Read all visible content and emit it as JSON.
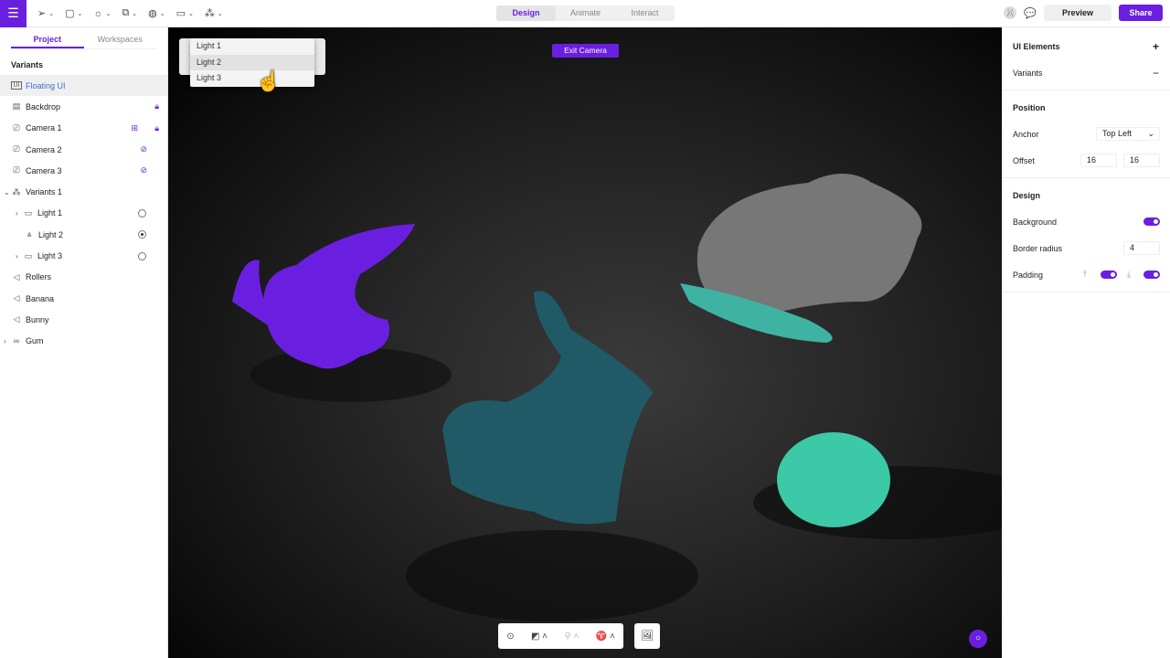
{
  "topbar": {
    "modes": [
      "Design",
      "Animate",
      "Interact"
    ],
    "active_mode": "Design",
    "preview": "Preview",
    "share": "Share"
  },
  "left": {
    "tabs": [
      "Project",
      "Workspaces"
    ],
    "section": "Variants",
    "items": [
      {
        "label": "Floating UI",
        "icon": "ui-icon"
      },
      {
        "label": "Backdrop",
        "icon": "backdrop-icon"
      },
      {
        "label": "Camera 1",
        "icon": "camera-icon"
      },
      {
        "label": "Camera 2",
        "icon": "camera-icon"
      },
      {
        "label": "Camera 3",
        "icon": "camera-icon"
      },
      {
        "label": "Variants 1",
        "icon": "variants-icon"
      },
      {
        "label": "Light 1",
        "icon": "folder-icon"
      },
      {
        "label": "Light 2",
        "icon": "light-icon"
      },
      {
        "label": "Light 3",
        "icon": "folder-icon"
      },
      {
        "label": "Rollers",
        "icon": "mesh-icon"
      },
      {
        "label": "Banana",
        "icon": "mesh-icon"
      },
      {
        "label": "Bunny",
        "icon": "mesh-icon"
      },
      {
        "label": "Gum",
        "icon": "group-icon"
      }
    ]
  },
  "canvas": {
    "dropdown": [
      "Light 1",
      "Light 2",
      "Light 3"
    ],
    "exit_camera": "Exit Camera"
  },
  "right": {
    "ui_elements": "UI Elements",
    "variants": "Variants",
    "position": "Position",
    "anchor_label": "Anchor",
    "anchor_value": "Top Left",
    "offset_label": "Offset",
    "offset_x": "16",
    "offset_y": "16",
    "design": "Design",
    "background": "Background",
    "border_radius_label": "Border radius",
    "border_radius": "4",
    "padding": "Padding"
  },
  "colors": {
    "accent": "#6a1fe0"
  }
}
